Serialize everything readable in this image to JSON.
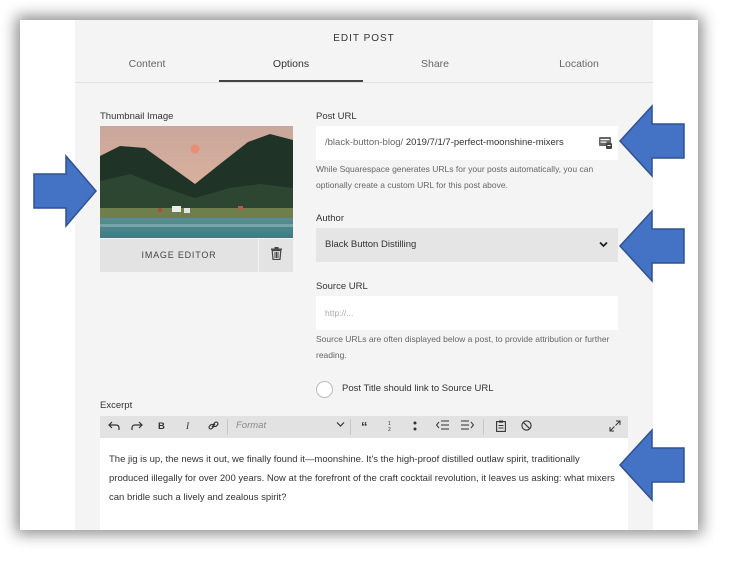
{
  "header": {
    "title": "EDIT POST"
  },
  "tabs": [
    {
      "label": "Content",
      "active": false
    },
    {
      "label": "Options",
      "active": true
    },
    {
      "label": "Share",
      "active": false
    },
    {
      "label": "Location",
      "active": false
    }
  ],
  "thumbnail": {
    "label": "Thumbnail Image",
    "editor_button": "IMAGE EDITOR"
  },
  "post_url": {
    "label": "Post URL",
    "prefix": "/black-button-blog/",
    "value": "2019/7/1/7-perfect-moonshine-mixers",
    "help": "While Squarespace generates URLs for your posts automatically, you can optionally create a custom URL for this post above."
  },
  "author": {
    "label": "Author",
    "selected": "Black Button Distilling"
  },
  "source_url": {
    "label": "Source URL",
    "placeholder": "http://...",
    "help": "Source URLs are often displayed below a post, to provide attribution or further reading."
  },
  "link_option": {
    "label": "Post Title should link to Source URL",
    "checked": false
  },
  "excerpt": {
    "label": "Excerpt",
    "toolbar": {
      "format_label": "Format"
    },
    "text": "The jig is up, the news it out, we finally found it—moonshine. It's the high-proof distilled outlaw spirit, traditionally produced illegally for over 200 years. Now at the forefront of the craft cocktail revolution, it leaves us asking: what mixers can bridle such a lively and zealous spirit?"
  },
  "colors": {
    "arrow": "#4472c4",
    "panel": "#f4f4f4",
    "text": "#333333"
  }
}
